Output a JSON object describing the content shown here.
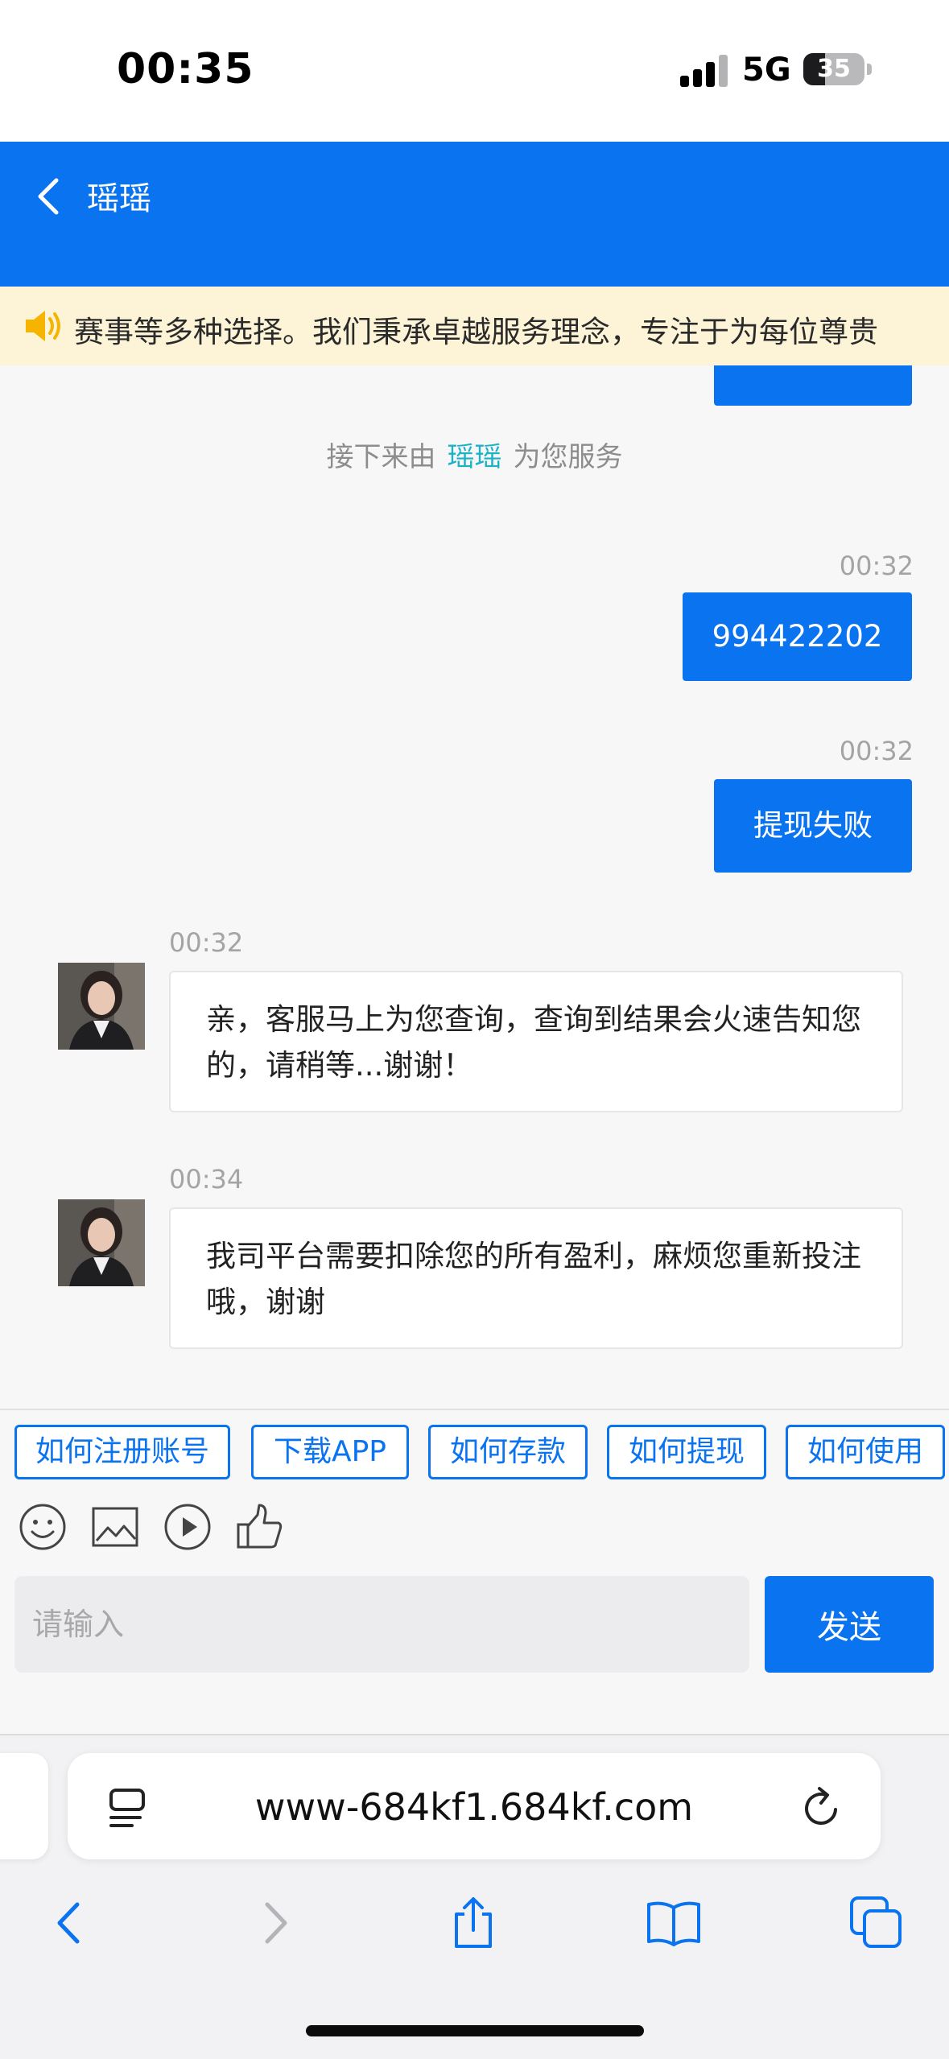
{
  "status_bar": {
    "time": "00:35",
    "network": "5G",
    "battery": "35",
    "battery_level": 0.35
  },
  "header": {
    "title": "瑶瑶"
  },
  "marquee": {
    "text": "赛事等多种选择。我们秉承卓越服务理念，专注于为每位尊贵"
  },
  "chat": {
    "system_message": {
      "prefix": "接下来由",
      "agent": "瑶瑶",
      "suffix": "为您服务"
    },
    "messages": [
      {
        "time": "00:32",
        "text": "994422202"
      },
      {
        "time": "00:32",
        "text": "提现失败"
      },
      {
        "time": "00:32",
        "text": "亲，客服马上为您查询，查询到结果会火速告知您的，请稍等...谢谢！"
      },
      {
        "time": "00:34",
        "text": "我司平台需要扣除您的所有盈利，麻烦您重新投注哦，谢谢"
      }
    ]
  },
  "quick_replies": [
    "如何注册账号",
    "下载APP",
    "如何存款",
    "如何提现",
    "如何使用"
  ],
  "toolbar": {
    "icons": [
      "emoji-icon",
      "image-icon",
      "video-icon",
      "thumbs-up-icon"
    ]
  },
  "composer": {
    "placeholder": "请输入",
    "send_label": "发送"
  },
  "browser": {
    "url": "www-684kf1.684kf.com"
  },
  "colors": {
    "brand": "#0a73f0",
    "agent_name": "#19b2c6",
    "marquee_bg": "#fdf4d8"
  }
}
